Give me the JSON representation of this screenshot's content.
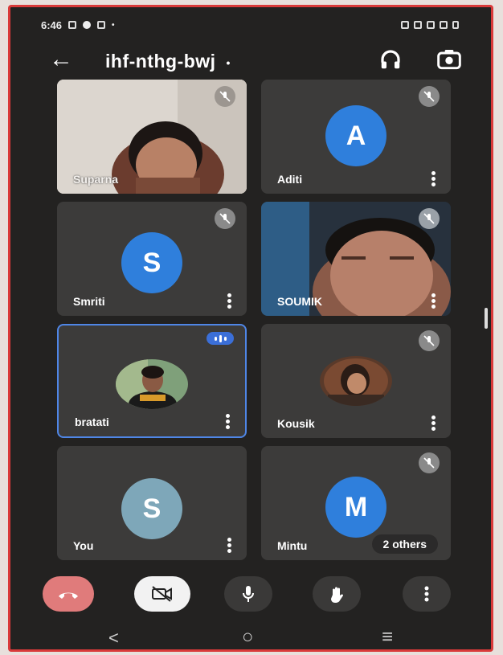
{
  "status": {
    "time": "6:46"
  },
  "header": {
    "meeting_code": "ihf-nthg-bwj",
    "dot": "•"
  },
  "tiles": [
    {
      "name": "Suparna",
      "type": "video",
      "muted": true
    },
    {
      "name": "Aditi",
      "initial": "A",
      "avatar_color": "#2f7fdc",
      "muted": true
    },
    {
      "name": "Smriti",
      "initial": "S",
      "avatar_color": "#2f7fdc",
      "muted": true
    },
    {
      "name": "SOUMIK",
      "type": "video",
      "muted": true
    },
    {
      "name": "bratati",
      "type": "photo",
      "speaking": true
    },
    {
      "name": "Kousik",
      "type": "photo",
      "muted": true
    },
    {
      "name": "You",
      "initial": "S",
      "avatar_color": "#7ea7b9"
    },
    {
      "name": "Mintu",
      "initial": "M",
      "avatar_color": "#2f7fdc",
      "muted": true,
      "others_label": "2 others"
    }
  ],
  "nav": {
    "back": "<",
    "home": "○",
    "recents": "≡"
  },
  "colors": {
    "end_call": "#e07b7b",
    "accent": "#3b6fd8",
    "tile_bg": "#3c3b3a"
  }
}
